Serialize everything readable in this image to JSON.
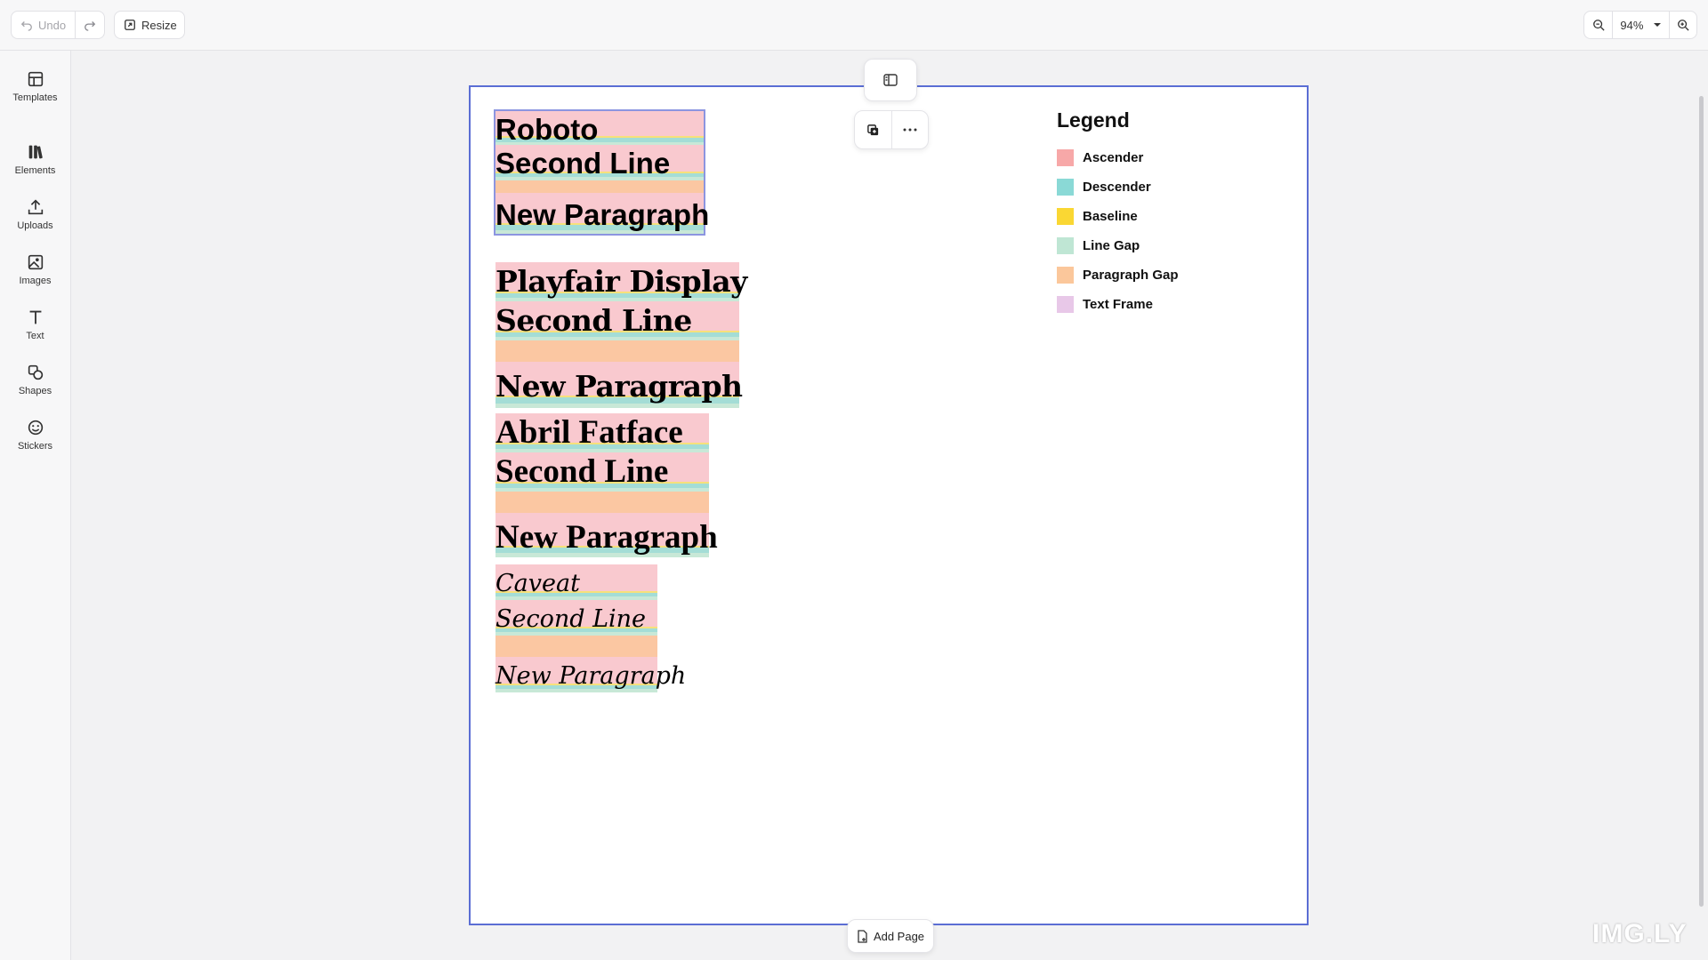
{
  "toolbar": {
    "undo_label": "Undo",
    "resize_label": "Resize",
    "zoom_value": "94%"
  },
  "sidebar": {
    "items": [
      {
        "label": "Templates",
        "icon": "templates-icon"
      },
      {
        "label": "Elements",
        "icon": "elements-icon"
      },
      {
        "label": "Uploads",
        "icon": "upload-icon"
      },
      {
        "label": "Images",
        "icon": "image-icon"
      },
      {
        "label": "Text",
        "icon": "text-icon"
      },
      {
        "label": "Shapes",
        "icon": "shapes-icon"
      },
      {
        "label": "Stickers",
        "icon": "sticker-icon"
      }
    ]
  },
  "canvas": {
    "add_page_label": "Add Page",
    "text_blocks": [
      {
        "font": "Roboto",
        "lines": [
          "Roboto",
          "Second Line",
          "New Paragraph"
        ],
        "selected": true
      },
      {
        "font": "Playfair Display",
        "lines": [
          "Playfair Display",
          "Second Line",
          "New Paragraph"
        ],
        "selected": false
      },
      {
        "font": "Abril Fatface",
        "lines": [
          "Abril Fatface",
          "Second Line",
          "New Paragraph"
        ],
        "selected": false
      },
      {
        "font": "Caveat",
        "lines": [
          "Caveat",
          "Second Line",
          "New Paragraph"
        ],
        "selected": false
      }
    ]
  },
  "legend": {
    "title": "Legend",
    "items": [
      {
        "label": "Ascender",
        "color": "#f7a8a8"
      },
      {
        "label": "Descender",
        "color": "#8ad9d6"
      },
      {
        "label": "Baseline",
        "color": "#fad733"
      },
      {
        "label": "Line Gap",
        "color": "#bfe6d4"
      },
      {
        "label": "Paragraph Gap",
        "color": "#fbc79b"
      },
      {
        "label": "Text Frame",
        "color": "#e8c8e8"
      }
    ]
  },
  "watermark": "IMG.LY",
  "colors": {
    "page_border": "#5b6ed4",
    "selection": "#8c95e0"
  }
}
